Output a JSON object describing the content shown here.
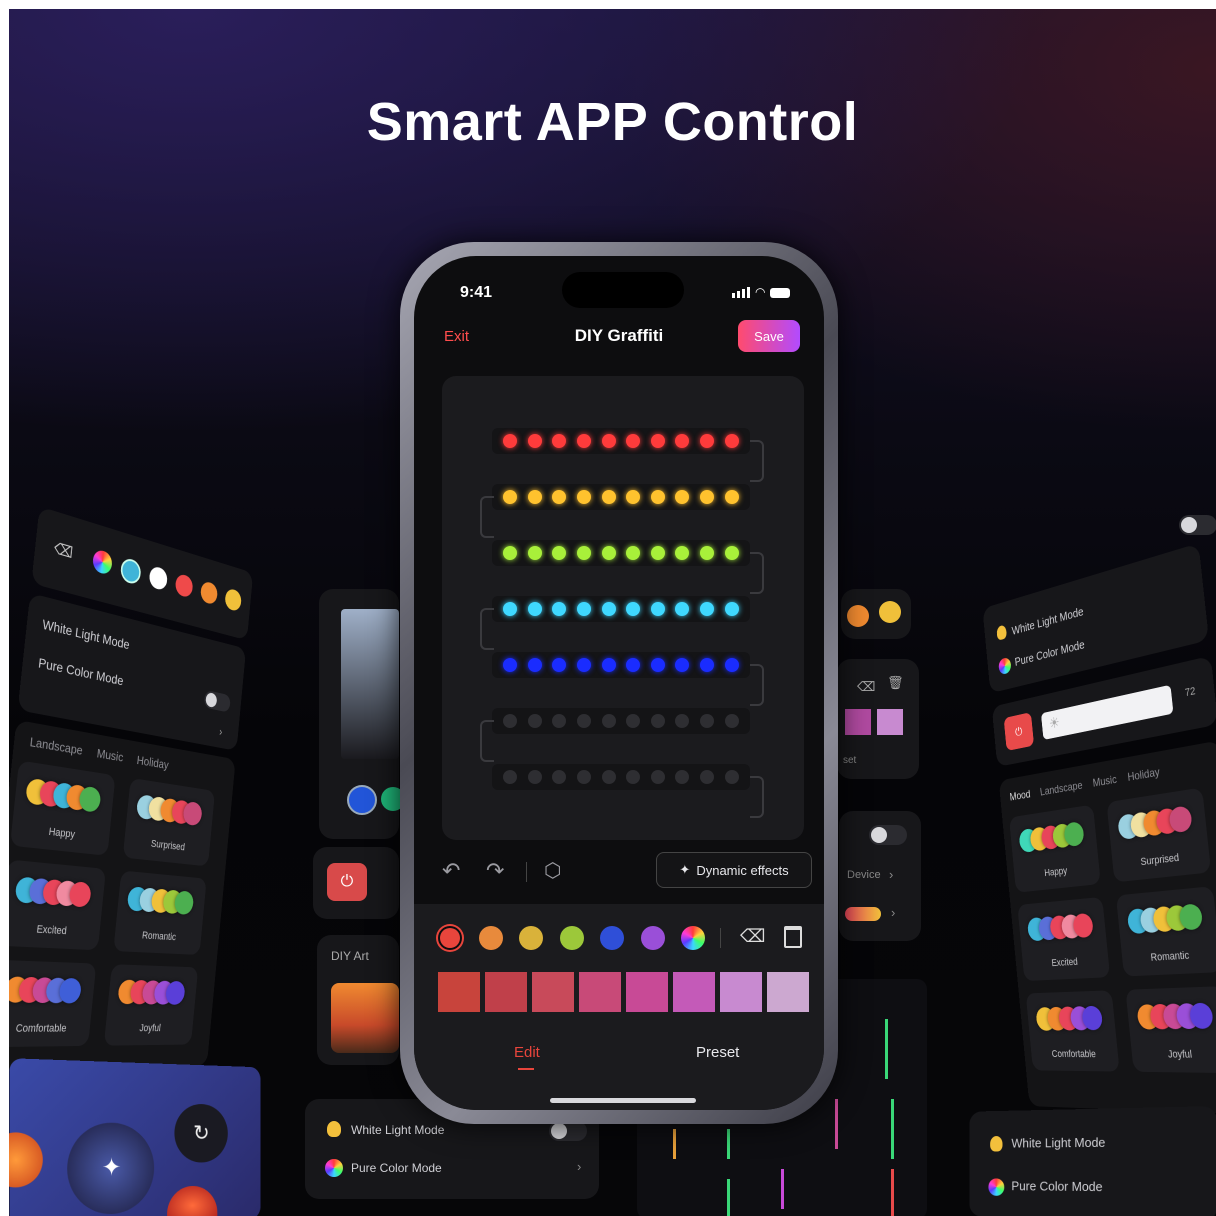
{
  "headline": "Smart APP Control",
  "phone": {
    "status_time": "9:41",
    "header": {
      "exit": "Exit",
      "title": "DIY Graffiti",
      "save": "Save"
    },
    "led_rows": [
      {
        "color": "#ff3b3b",
        "lit": true
      },
      {
        "color": "#ffc22e",
        "lit": true
      },
      {
        "color": "#a8f03a",
        "lit": true
      },
      {
        "color": "#3fd8ff",
        "lit": true
      },
      {
        "color": "#1a2cff",
        "lit": true
      },
      {
        "color": "#2e2e32",
        "lit": false
      },
      {
        "color": "#2e2e32",
        "lit": false
      }
    ],
    "toolbar": {
      "undo_icon": "undo-icon",
      "redo_icon": "redo-icon",
      "random_icon": "dice-icon",
      "dynamic_effects": "Dynamic effects"
    },
    "palette_colors": [
      "#e8453c",
      "#e88a3c",
      "#d9b23a",
      "#9cc83a",
      "#2f4fd8",
      "#9a4fd8",
      "multicolor"
    ],
    "shades": [
      "#c8443c",
      "#c0404a",
      "#c84a5a",
      "#c84a78",
      "#c84a96",
      "#c45ab8",
      "#c88ad0",
      "#cca8d0"
    ],
    "tabs": {
      "edit": "Edit",
      "preset": "Preset"
    }
  },
  "left_panel": {
    "white_light": "White Light Mode",
    "pure_color": "Pure Color Mode",
    "categories": [
      "Landscape",
      "Music",
      "Holiday"
    ],
    "presets": [
      "Happy",
      "Surprised",
      "Excited",
      "Romantic",
      "Comfortable",
      "Joyful"
    ],
    "diy_art": "DIY Art"
  },
  "right_panel": {
    "white_light": "White Light Mode",
    "pure_color": "Pure Color Mode",
    "brightness": "72",
    "categories": [
      "Mood",
      "Landscape",
      "Music",
      "Holiday"
    ],
    "presets": [
      "Happy",
      "Surprised",
      "Excited",
      "Romantic",
      "Comfortable",
      "Joyful"
    ]
  },
  "bottom_left_card": {
    "white_light": "White Light Mode",
    "pure_color": "Pure Color Mode"
  },
  "bottom_right_card": {
    "white_light": "White Light Mode",
    "pure_color": "Pure Color Mode"
  },
  "mid_right_card": {
    "device": "Device",
    "preset": "set"
  }
}
